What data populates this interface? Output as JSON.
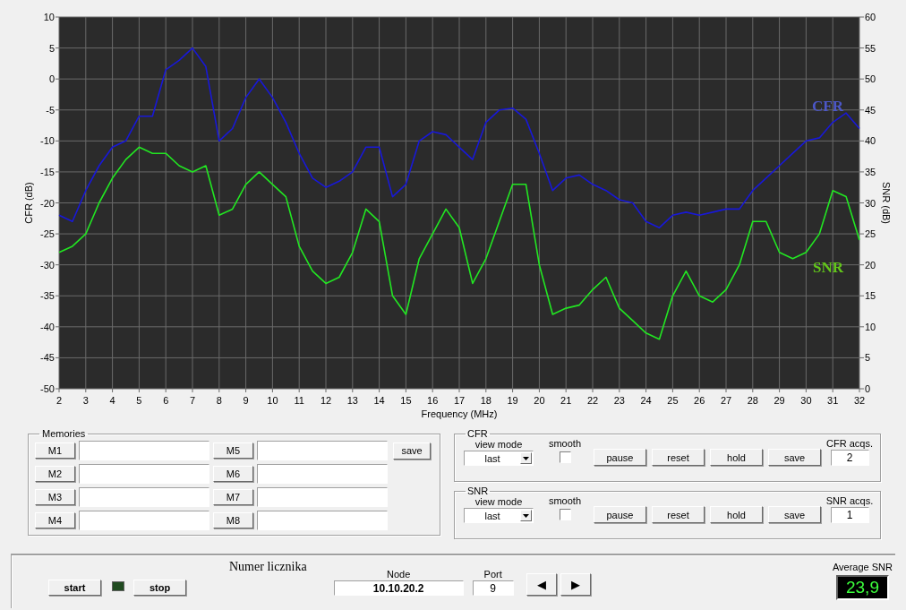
{
  "chart": {
    "chart_data": {
      "type": "line",
      "xlabel": "Frequency (MHz)",
      "ylabel": "CFR (dB)",
      "y2label": "SNR (dB)",
      "x": [
        2,
        2.5,
        3,
        3.5,
        4,
        4.5,
        5,
        5.5,
        6,
        6.5,
        7,
        7.5,
        8,
        8.5,
        9,
        9.5,
        10,
        10.5,
        11,
        11.5,
        12,
        12.5,
        13,
        13.5,
        14,
        14.5,
        15,
        15.5,
        16,
        16.5,
        17,
        17.5,
        18,
        18.5,
        19,
        19.5,
        20,
        20.5,
        21,
        21.5,
        22,
        22.5,
        23,
        23.5,
        24,
        24.5,
        25,
        25.5,
        26,
        26.5,
        27,
        27.5,
        28,
        28.5,
        29,
        29.5,
        30,
        30.5,
        31,
        31.5,
        32
      ],
      "grid": true,
      "xlim": [
        2,
        32
      ],
      "ylim": [
        -50,
        10
      ],
      "y2lim": [
        0,
        60
      ],
      "xticks": [
        2,
        3,
        4,
        5,
        6,
        7,
        8,
        9,
        10,
        11,
        12,
        13,
        14,
        15,
        16,
        17,
        18,
        19,
        20,
        21,
        22,
        23,
        24,
        25,
        26,
        27,
        28,
        29,
        30,
        31,
        32
      ],
      "yticks": [
        -50,
        -45,
        -40,
        -35,
        -30,
        -25,
        -20,
        -15,
        -10,
        -5,
        0,
        5,
        10
      ],
      "y2ticks": [
        0,
        5,
        10,
        15,
        20,
        25,
        30,
        35,
        40,
        45,
        50,
        55,
        60
      ],
      "series": [
        {
          "name": "CFR",
          "color": "#1818d8",
          "values": [
            -22,
            -23,
            -18,
            -14,
            -11,
            -10,
            -6,
            -6,
            1.5,
            3,
            5,
            2,
            -10,
            -8,
            -3,
            0,
            -3,
            -7,
            -12,
            -16,
            -17.5,
            -16.5,
            -15,
            -11,
            -11,
            -19,
            -17,
            -10,
            -8.5,
            -9,
            -11,
            -13,
            -7,
            -5,
            -4.7,
            -6.5,
            -12,
            -18,
            -16,
            -15.5,
            -17,
            -18,
            -19.5,
            -20,
            -23,
            -24,
            -22,
            -21.5,
            -22,
            -21.5,
            -21,
            -21,
            -18,
            -16,
            -14,
            -12,
            -10,
            -9.5,
            -7,
            -5.5,
            -8
          ]
        },
        {
          "name": "SNR",
          "color": "#22e622",
          "axis": "y2",
          "values": [
            22,
            23,
            25,
            30,
            34,
            37,
            39,
            38,
            38,
            36,
            35,
            36,
            28,
            29,
            33,
            35,
            33,
            31,
            23,
            19,
            17,
            18,
            22,
            29,
            27,
            15,
            12,
            21,
            25,
            29,
            26,
            17,
            21,
            27,
            33,
            33,
            20,
            12,
            13,
            13.5,
            16,
            18,
            13,
            11,
            9,
            8,
            15,
            19,
            15,
            14,
            16,
            20,
            27,
            27,
            22,
            21,
            22,
            25,
            32,
            31,
            24
          ]
        }
      ]
    }
  },
  "memories": {
    "title": "Memories",
    "slots": [
      {
        "label": "M1"
      },
      {
        "label": "M2"
      },
      {
        "label": "M3"
      },
      {
        "label": "M4"
      },
      {
        "label": "M5"
      },
      {
        "label": "M6"
      },
      {
        "label": "M7"
      },
      {
        "label": "M8"
      }
    ],
    "save_label": "save"
  },
  "panels": [
    {
      "title": "CFR",
      "view_mode_label": "view mode",
      "view_mode": "last",
      "smooth_label": "smooth",
      "smooth": false,
      "buttons": [
        "pause",
        "reset",
        "hold",
        "save"
      ],
      "acqs_label": "CFR acqs.",
      "acqs": "2"
    },
    {
      "title": "SNR",
      "view_mode_label": "view mode",
      "view_mode": "last",
      "smooth_label": "smooth",
      "smooth": false,
      "buttons": [
        "pause",
        "reset",
        "hold",
        "save"
      ],
      "acqs_label": "SNR acqs.",
      "acqs": "1"
    }
  ],
  "status_bar": {
    "start_label": "start",
    "led_on": false,
    "stop_label": "stop",
    "meter_label": "Numer licznika",
    "node_label": "Node",
    "node": "10.10.20.2",
    "port_label": "Port",
    "port": "9",
    "prev_label": "◀",
    "next_label": "▶",
    "avg_label": "Average SNR",
    "avg_value": "23,9"
  }
}
